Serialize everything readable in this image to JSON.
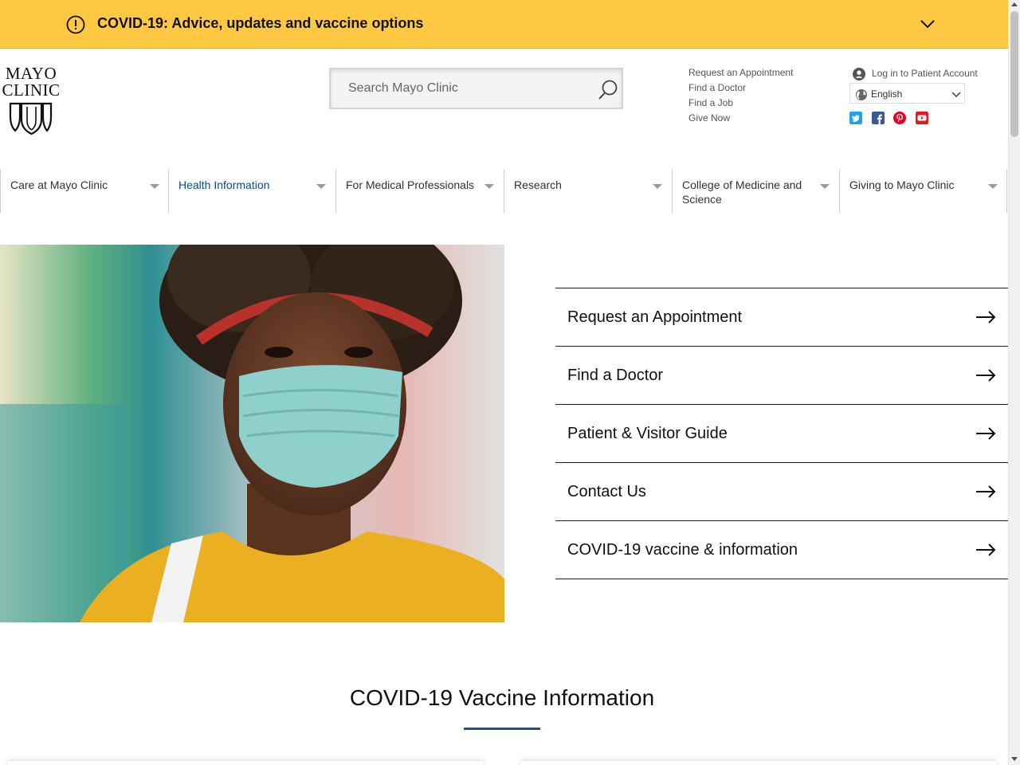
{
  "banner": {
    "text": "COVID-19: Advice, updates and vaccine options",
    "background": "#ffc843"
  },
  "logo": {
    "line1": "MAYO",
    "line2": "CLINIC"
  },
  "search": {
    "placeholder": "Search Mayo Clinic",
    "icon": "search-icon"
  },
  "utility_links": [
    "Request an Appointment",
    "Find a Doctor",
    "Find a Job",
    "Give Now"
  ],
  "account": {
    "label": "Log in to Patient Account"
  },
  "language": {
    "selected": "English"
  },
  "social": [
    {
      "name": "twitter-icon",
      "color": "#1da1f2"
    },
    {
      "name": "facebook-icon",
      "color": "#3b5998"
    },
    {
      "name": "pinterest-icon",
      "color": "#e60023"
    },
    {
      "name": "youtube-icon",
      "color": "#ff0000"
    }
  ],
  "nav": {
    "active_color": "#0b4a8b",
    "items": [
      {
        "label": "Care at Mayo Clinic"
      },
      {
        "label": "Health Information"
      },
      {
        "label": "For Medical Professionals"
      },
      {
        "label": "Research"
      },
      {
        "label": "College of Medicine and Science"
      },
      {
        "label": "Giving to Mayo Clinic"
      }
    ]
  },
  "quick_links": [
    "Request an Appointment",
    "Find a Doctor",
    "Patient & Visitor Guide",
    "Contact Us",
    "COVID-19 vaccine & information"
  ],
  "section": {
    "title": "COVID-19 Vaccine Information",
    "rule_color": "#1e4f91"
  }
}
